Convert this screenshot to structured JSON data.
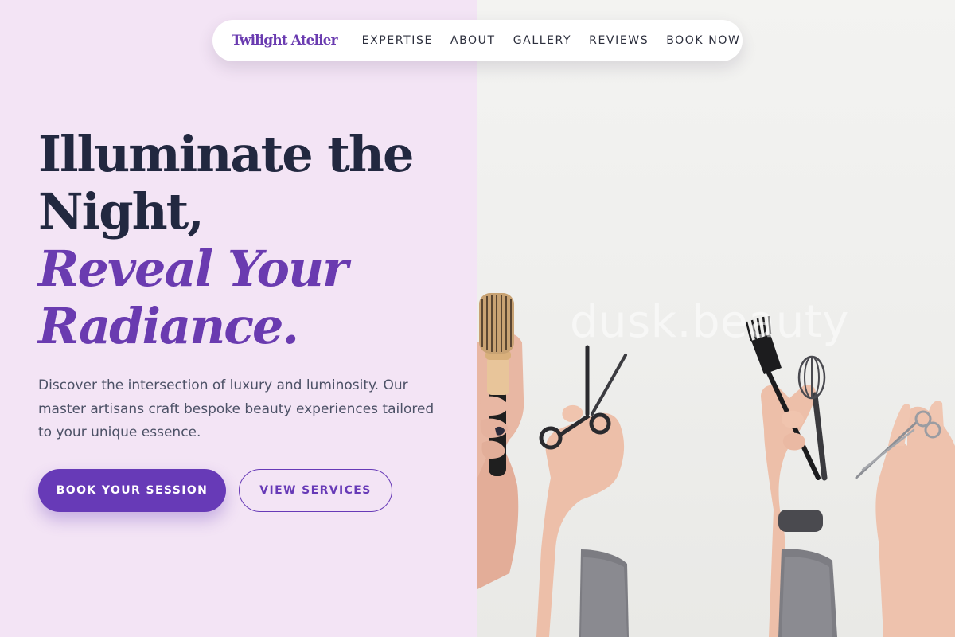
{
  "nav": {
    "brand": "Twilight Atelier",
    "links": [
      "EXPERTISE",
      "ABOUT",
      "GALLERY",
      "REVIEWS",
      "BOOK NOW"
    ]
  },
  "hero": {
    "title_line1": "Illuminate the",
    "title_line2": "Night,",
    "title_line3": "Reveal Your",
    "title_line4": "Radiance.",
    "description": "Discover the intersection of luxury and luminosity. Our master artisans craft bespoke beauty experiences tailored to your unique essence.",
    "primary_button": "BOOK YOUR SESSION",
    "secondary_button": "VIEW SERVICES"
  },
  "image": {
    "watermark": "dusk.beauty"
  },
  "colors": {
    "accent": "#673ab7",
    "heading": "#222840",
    "background": "#f3e4f5"
  }
}
